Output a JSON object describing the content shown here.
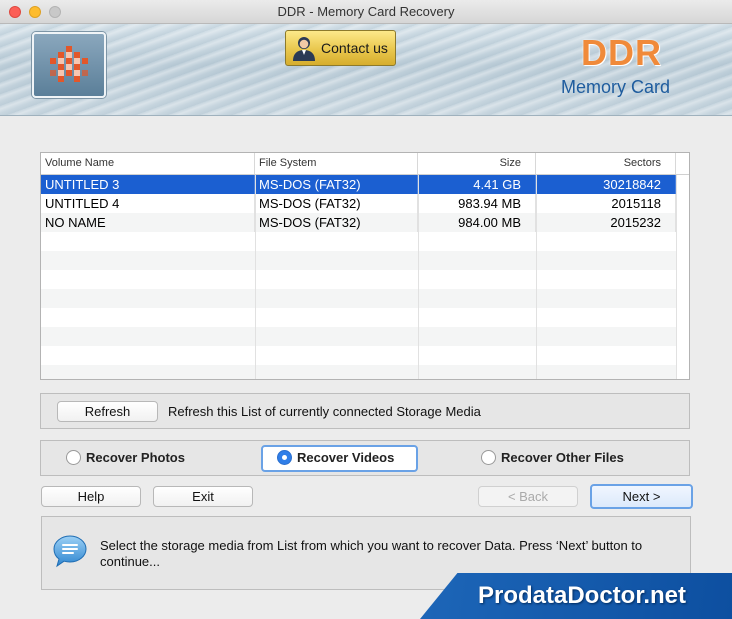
{
  "window": {
    "title": "DDR - Memory Card Recovery"
  },
  "header": {
    "contact_label": "Contact us",
    "brand_title": "DDR",
    "brand_subtitle": "Memory Card"
  },
  "media_list": {
    "columns": [
      "Volume Name",
      "File System",
      "Size",
      "Sectors"
    ],
    "rows": [
      {
        "name": "UNTITLED 3",
        "fs": "MS-DOS (FAT32)",
        "size": "4.41  GB",
        "sectors": "30218842",
        "selected": true
      },
      {
        "name": "UNTITLED 4",
        "fs": "MS-DOS (FAT32)",
        "size": "983.94  MB",
        "sectors": "2015118",
        "selected": false
      },
      {
        "name": "NO NAME",
        "fs": "MS-DOS (FAT32)",
        "size": "984.00  MB",
        "sectors": "2015232",
        "selected": false
      }
    ]
  },
  "refresh": {
    "button_label": "Refresh",
    "description": "Refresh this List of currently connected Storage Media"
  },
  "recovery_mode": {
    "options": [
      "Recover Photos",
      "Recover Videos",
      "Recover Other Files"
    ],
    "selected": "Recover Videos"
  },
  "actions": {
    "help": "Help",
    "exit": "Exit",
    "back": "< Back",
    "next": "Next >"
  },
  "info": {
    "message": "Select the storage media from List from which you want to recover Data. Press ‘Next’ button to continue..."
  },
  "watermark": {
    "text": "ProdataDoctor.net"
  },
  "colors": {
    "selection": "#1b5fd1",
    "brand_orange": "#f08a3a",
    "brand_blue": "#1e5c9e",
    "contact_gold": "#e9c74d"
  },
  "icons": [
    "logo-icon",
    "contact-person-icon",
    "speech-bubble-icon"
  ]
}
